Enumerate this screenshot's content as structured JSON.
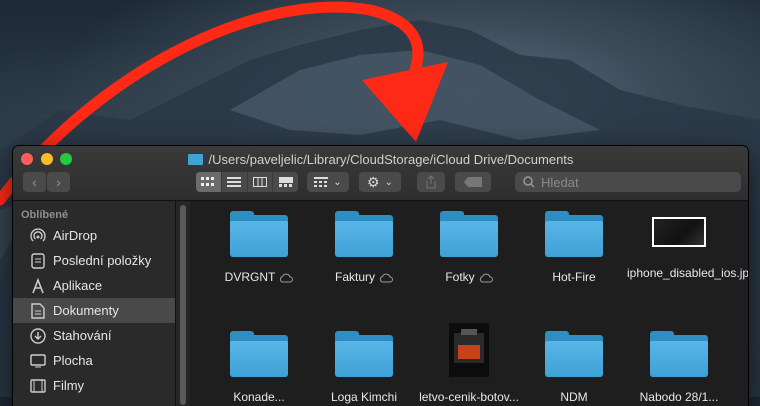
{
  "window": {
    "title": "/Users/paveljelic/Library/CloudStorage/iCloud Drive/Documents",
    "search_placeholder": "Hledat"
  },
  "toolbar": {
    "view_modes": [
      "icon-view-icon",
      "list-view-icon",
      "column-view-icon",
      "gallery-view-icon"
    ],
    "active_view": "icon-view-icon"
  },
  "sidebar": {
    "heading": "Oblíbené",
    "items": [
      {
        "label": "AirDrop",
        "icon": "airdrop-icon"
      },
      {
        "label": "Poslední položky",
        "icon": "recents-icon"
      },
      {
        "label": "Aplikace",
        "icon": "applications-icon"
      },
      {
        "label": "Dokumenty",
        "icon": "documents-icon",
        "selected": true
      },
      {
        "label": "Stahování",
        "icon": "downloads-icon"
      },
      {
        "label": "Plocha",
        "icon": "desktop-icon"
      },
      {
        "label": "Filmy",
        "icon": "movies-icon"
      }
    ]
  },
  "files": [
    {
      "name": "DVRGNT",
      "kind": "folder",
      "cloud": true
    },
    {
      "name": "Faktury",
      "kind": "folder",
      "cloud": true
    },
    {
      "name": "Fotky",
      "kind": "folder",
      "cloud": true
    },
    {
      "name": "Hot-Fire",
      "kind": "folder",
      "cloud": false
    },
    {
      "name": "iphone_disabled_ios.jpeg",
      "kind": "image",
      "cloud": false
    },
    {
      "name": "Konade...",
      "kind": "folder",
      "cloud": true
    },
    {
      "name": "Loga Kimchi",
      "kind": "folder",
      "cloud": true
    },
    {
      "name": "letvo-cenik-botov...",
      "kind": "document",
      "cloud": false
    },
    {
      "name": "NDM",
      "kind": "folder",
      "cloud": true
    },
    {
      "name": "Nabodo 28/1...",
      "kind": "folder",
      "cloud": true
    }
  ],
  "colors": {
    "arrow": "#ff2a16",
    "folder": "#3ea1d6",
    "selection": "#494949"
  }
}
